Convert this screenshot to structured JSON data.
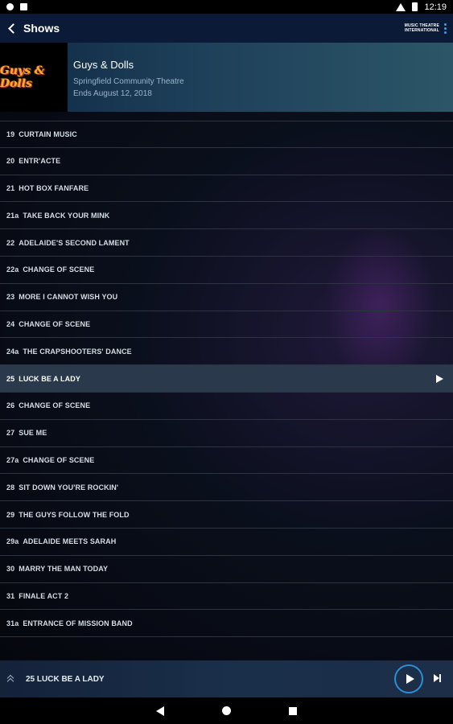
{
  "status_bar": {
    "time": "12:19"
  },
  "app_bar": {
    "title": "Shows",
    "brand_line1": "MUSIC THEATRE",
    "brand_line2": "INTERNATIONAL"
  },
  "show": {
    "logo_text": "Guys & Dolls",
    "title": "Guys & Dolls",
    "venue": "Springfield Community Theatre",
    "dates": "Ends August 12, 2018"
  },
  "tracks": [
    {
      "num": "19",
      "title": "CURTAIN MUSIC"
    },
    {
      "num": "20",
      "title": "ENTR'ACTE"
    },
    {
      "num": "21",
      "title": "HOT BOX FANFARE"
    },
    {
      "num": "21a",
      "title": "TAKE BACK YOUR MINK"
    },
    {
      "num": "22",
      "title": "ADELAIDE'S SECOND LAMENT"
    },
    {
      "num": "22a",
      "title": "CHANGE OF SCENE"
    },
    {
      "num": "23",
      "title": "MORE I CANNOT WISH YOU"
    },
    {
      "num": "24",
      "title": "CHANGE OF SCENE"
    },
    {
      "num": "24a",
      "title": "THE CRAPSHOOTERS' DANCE"
    },
    {
      "num": "25",
      "title": "LUCK BE A LADY"
    },
    {
      "num": "26",
      "title": "CHANGE OF SCENE"
    },
    {
      "num": "27",
      "title": "SUE ME"
    },
    {
      "num": "27a",
      "title": "CHANGE OF SCENE"
    },
    {
      "num": "28",
      "title": "SIT DOWN YOU'RE ROCKIN'"
    },
    {
      "num": "29",
      "title": "THE GUYS FOLLOW THE FOLD"
    },
    {
      "num": "29a",
      "title": "ADELAIDE MEETS SARAH"
    },
    {
      "num": "30",
      "title": "MARRY THE MAN TODAY"
    },
    {
      "num": "31",
      "title": "FINALE ACT 2"
    },
    {
      "num": "31a",
      "title": "ENTRANCE OF MISSION BAND"
    }
  ],
  "active_track_index": 9,
  "player": {
    "now_playing": "25 LUCK BE A LADY"
  }
}
